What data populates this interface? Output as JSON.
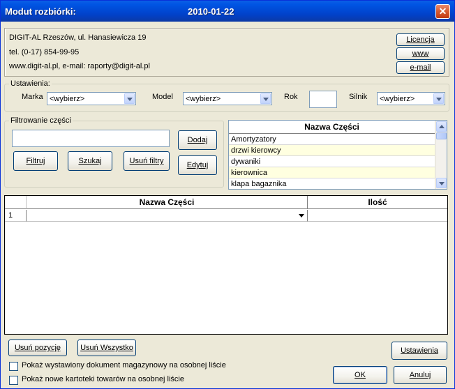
{
  "window": {
    "title": "Modut rozbiórki:",
    "date": "2010-01-22",
    "close_glyph": "✕"
  },
  "company": {
    "line1": "DIGIT-AL Rzeszów, ul. Hanasiewicza 19",
    "line2": "tel. (0-17) 854-99-95",
    "line3": "www.digit-al.pl,  e-mail: raporty@digit-al.pl"
  },
  "links": {
    "licencja": "Licencja",
    "www": "www",
    "email": "e-mail"
  },
  "settings": {
    "legend": "Ustawienia:",
    "marka_label": "Marka",
    "marka_value": "<wybierz>",
    "model_label": "Model",
    "model_value": "<wybierz>",
    "rok_label": "Rok",
    "silnik_label": "Silnik",
    "silnik_value": "<wybierz>"
  },
  "filter": {
    "legend": "Filtrowanie części",
    "add": "Dodaj",
    "edit": "Edytuj",
    "filter_btn": "Filtruj",
    "search_btn": "Szukaj",
    "clear_btn": "Usuń filtry"
  },
  "parts_list": {
    "header": "Nazwa Części",
    "items": [
      "Amortyzatory",
      "drzwi kierowcy",
      "dywaniki",
      "kierownica",
      "klapa bagaznika"
    ]
  },
  "grid": {
    "col_name": "Nazwa Części",
    "col_qty": "Ilość",
    "row_number": "1"
  },
  "bottom": {
    "remove_item": "Usuń pozycję",
    "remove_all": "Usuń Wszystko",
    "settings": "Ustawienia",
    "ok": "OK",
    "cancel": "Anuluj",
    "check1": "Pokaż wystawiony dokument magazynowy na osobnej liście",
    "check2": "Pokaż nowe kartoteki towarów na osobnej liście"
  }
}
